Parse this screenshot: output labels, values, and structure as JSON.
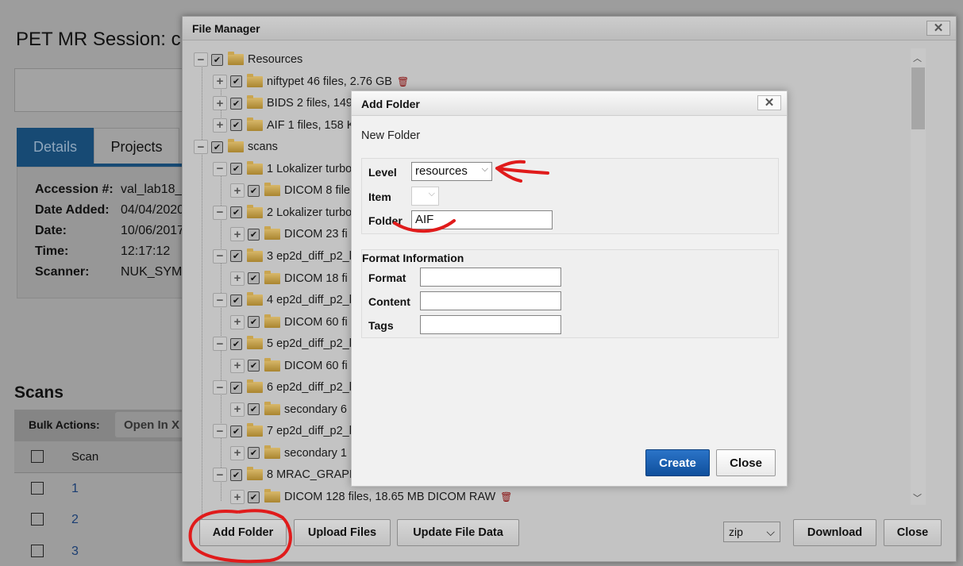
{
  "page": {
    "title": "PET MR Session: c",
    "tabs": [
      {
        "label": "Details"
      },
      {
        "label": "Projects"
      }
    ],
    "details": [
      {
        "label": "Accession #:",
        "value": "val_lab18_"
      },
      {
        "label": "Date Added:",
        "value": "04/04/2020"
      },
      {
        "label": "Date:",
        "value": "10/06/2017"
      },
      {
        "label": "Time:",
        "value": "12:17:12"
      },
      {
        "label": "Scanner:",
        "value": "NUK_SYM"
      }
    ],
    "scans": {
      "heading": "Scans",
      "bulk_label": "Bulk Actions:",
      "bulk_button": "Open In X",
      "column": "Scan",
      "rows": [
        "1",
        "2",
        "3"
      ]
    }
  },
  "file_manager": {
    "title": "File Manager",
    "close_x": "✕",
    "tree": [
      {
        "level": 0,
        "exp": "−",
        "name": "Resources"
      },
      {
        "level": 1,
        "exp": "+",
        "name": "niftypet  46 files, 2.76 GB",
        "trash": true
      },
      {
        "level": 1,
        "exp": "+",
        "name": "BIDS  2 files, 149"
      },
      {
        "level": 1,
        "exp": "+",
        "name": "AIF  1 files, 158 K"
      },
      {
        "level": 0,
        "exp": "−",
        "name": "scans"
      },
      {
        "level": 1,
        "exp": "−",
        "name": "1 Lokalizer turbo"
      },
      {
        "level": 2,
        "exp": "+",
        "name": "DICOM  8 file"
      },
      {
        "level": 1,
        "exp": "−",
        "name": "2 Lokalizer turbo"
      },
      {
        "level": 2,
        "exp": "+",
        "name": "DICOM  23 fi"
      },
      {
        "level": 1,
        "exp": "−",
        "name": "3 ep2d_diff_p2_b"
      },
      {
        "level": 2,
        "exp": "+",
        "name": "DICOM  18 fi"
      },
      {
        "level": 1,
        "exp": "−",
        "name": "4 ep2d_diff_p2_b"
      },
      {
        "level": 2,
        "exp": "+",
        "name": "DICOM  60 fi"
      },
      {
        "level": 1,
        "exp": "−",
        "name": "5 ep2d_diff_p2_b"
      },
      {
        "level": 2,
        "exp": "+",
        "name": "DICOM  60 fi"
      },
      {
        "level": 1,
        "exp": "−",
        "name": "6 ep2d_diff_p2_b"
      },
      {
        "level": 2,
        "exp": "+",
        "name": "secondary  6"
      },
      {
        "level": 1,
        "exp": "−",
        "name": "7 ep2d_diff_p2_b"
      },
      {
        "level": 2,
        "exp": "+",
        "name": "secondary  1"
      },
      {
        "level": 1,
        "exp": "−",
        "name": "8 MRAC_GRAPP"
      },
      {
        "level": 2,
        "exp": "+",
        "name": "DICOM  128 files, 18.65 MB DICOM RAW",
        "trash": true
      }
    ],
    "buttons": {
      "add_folder": "Add Folder",
      "upload": "Upload Files",
      "update": "Update File Data",
      "format": "zip",
      "download": "Download",
      "close": "Close"
    }
  },
  "add_folder": {
    "title": "Add Folder",
    "close_x": "✕",
    "subtitle": "New Folder",
    "level_label": "Level",
    "level_value": "resources",
    "item_label": "Item",
    "item_value": "",
    "folder_label": "Folder",
    "folder_value": "AIF",
    "format_heading": "Format Information",
    "format_label": "Format",
    "format_value": "",
    "content_label": "Content",
    "content_value": "",
    "tags_label": "Tags",
    "tags_value": "",
    "create": "Create",
    "close": "Close"
  },
  "colors": {
    "accent": "#1a5fad",
    "annotation": "#e01b1b"
  }
}
